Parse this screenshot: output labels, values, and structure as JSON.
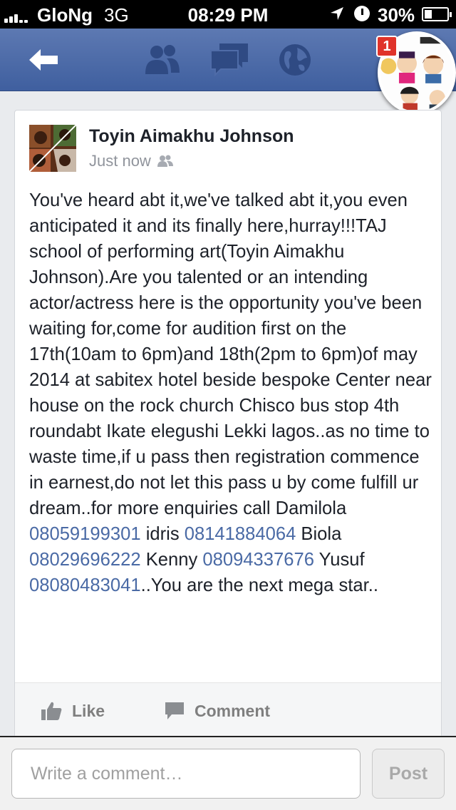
{
  "status_bar": {
    "carrier": "GloNg",
    "network": "3G",
    "time": "08:29 PM",
    "battery": "30%",
    "icons": [
      "signal-bars",
      "location-arrow",
      "clock",
      "battery"
    ]
  },
  "nav": {
    "icons": [
      "back-arrow",
      "friends",
      "messages",
      "globe"
    ],
    "chat_head_badge": "1",
    "colors": {
      "bar": "#4b67a6",
      "icon": "#2f4a83"
    }
  },
  "post": {
    "author": "Toyin Aimakhu Johnson",
    "timestamp": "Just now",
    "audience_icon": "friends",
    "body": [
      {
        "text": "You've heard abt it,we've talked abt it,you even anticipated it and its finally here,hurray!!!TAJ school of performing art(Toyin Aimakhu Johnson).Are you talented or an intending actor/actress here is the opportunity you've been waiting for,come for audition first on the 17th(10am to 6pm)and 18th(2pm to 6pm)of may 2014 at sabitex hotel beside bespoke Center near house on the rock church Chisco bus stop 4th roundabt Ikate elegushi Lekki lagos..as no time to waste time,if u pass then registration commence in earnest,do not let this pass u by come fulfill ur dream..for more enquiries call Damilola "
      },
      {
        "link": "08059199301"
      },
      {
        "text": " idris "
      },
      {
        "link": "08141884064"
      },
      {
        "text": " Biola "
      },
      {
        "link": "08029696222"
      },
      {
        "text": " Kenny "
      },
      {
        "link": "08094337676"
      },
      {
        "text": " Yusuf "
      },
      {
        "link": "08080483041"
      },
      {
        "text": "..You are the next mega star.."
      }
    ],
    "link_color": "#4a6aa5"
  },
  "actions": {
    "like": "Like",
    "comment": "Comment"
  },
  "composer": {
    "placeholder": "Write a comment…",
    "post_label": "Post"
  }
}
